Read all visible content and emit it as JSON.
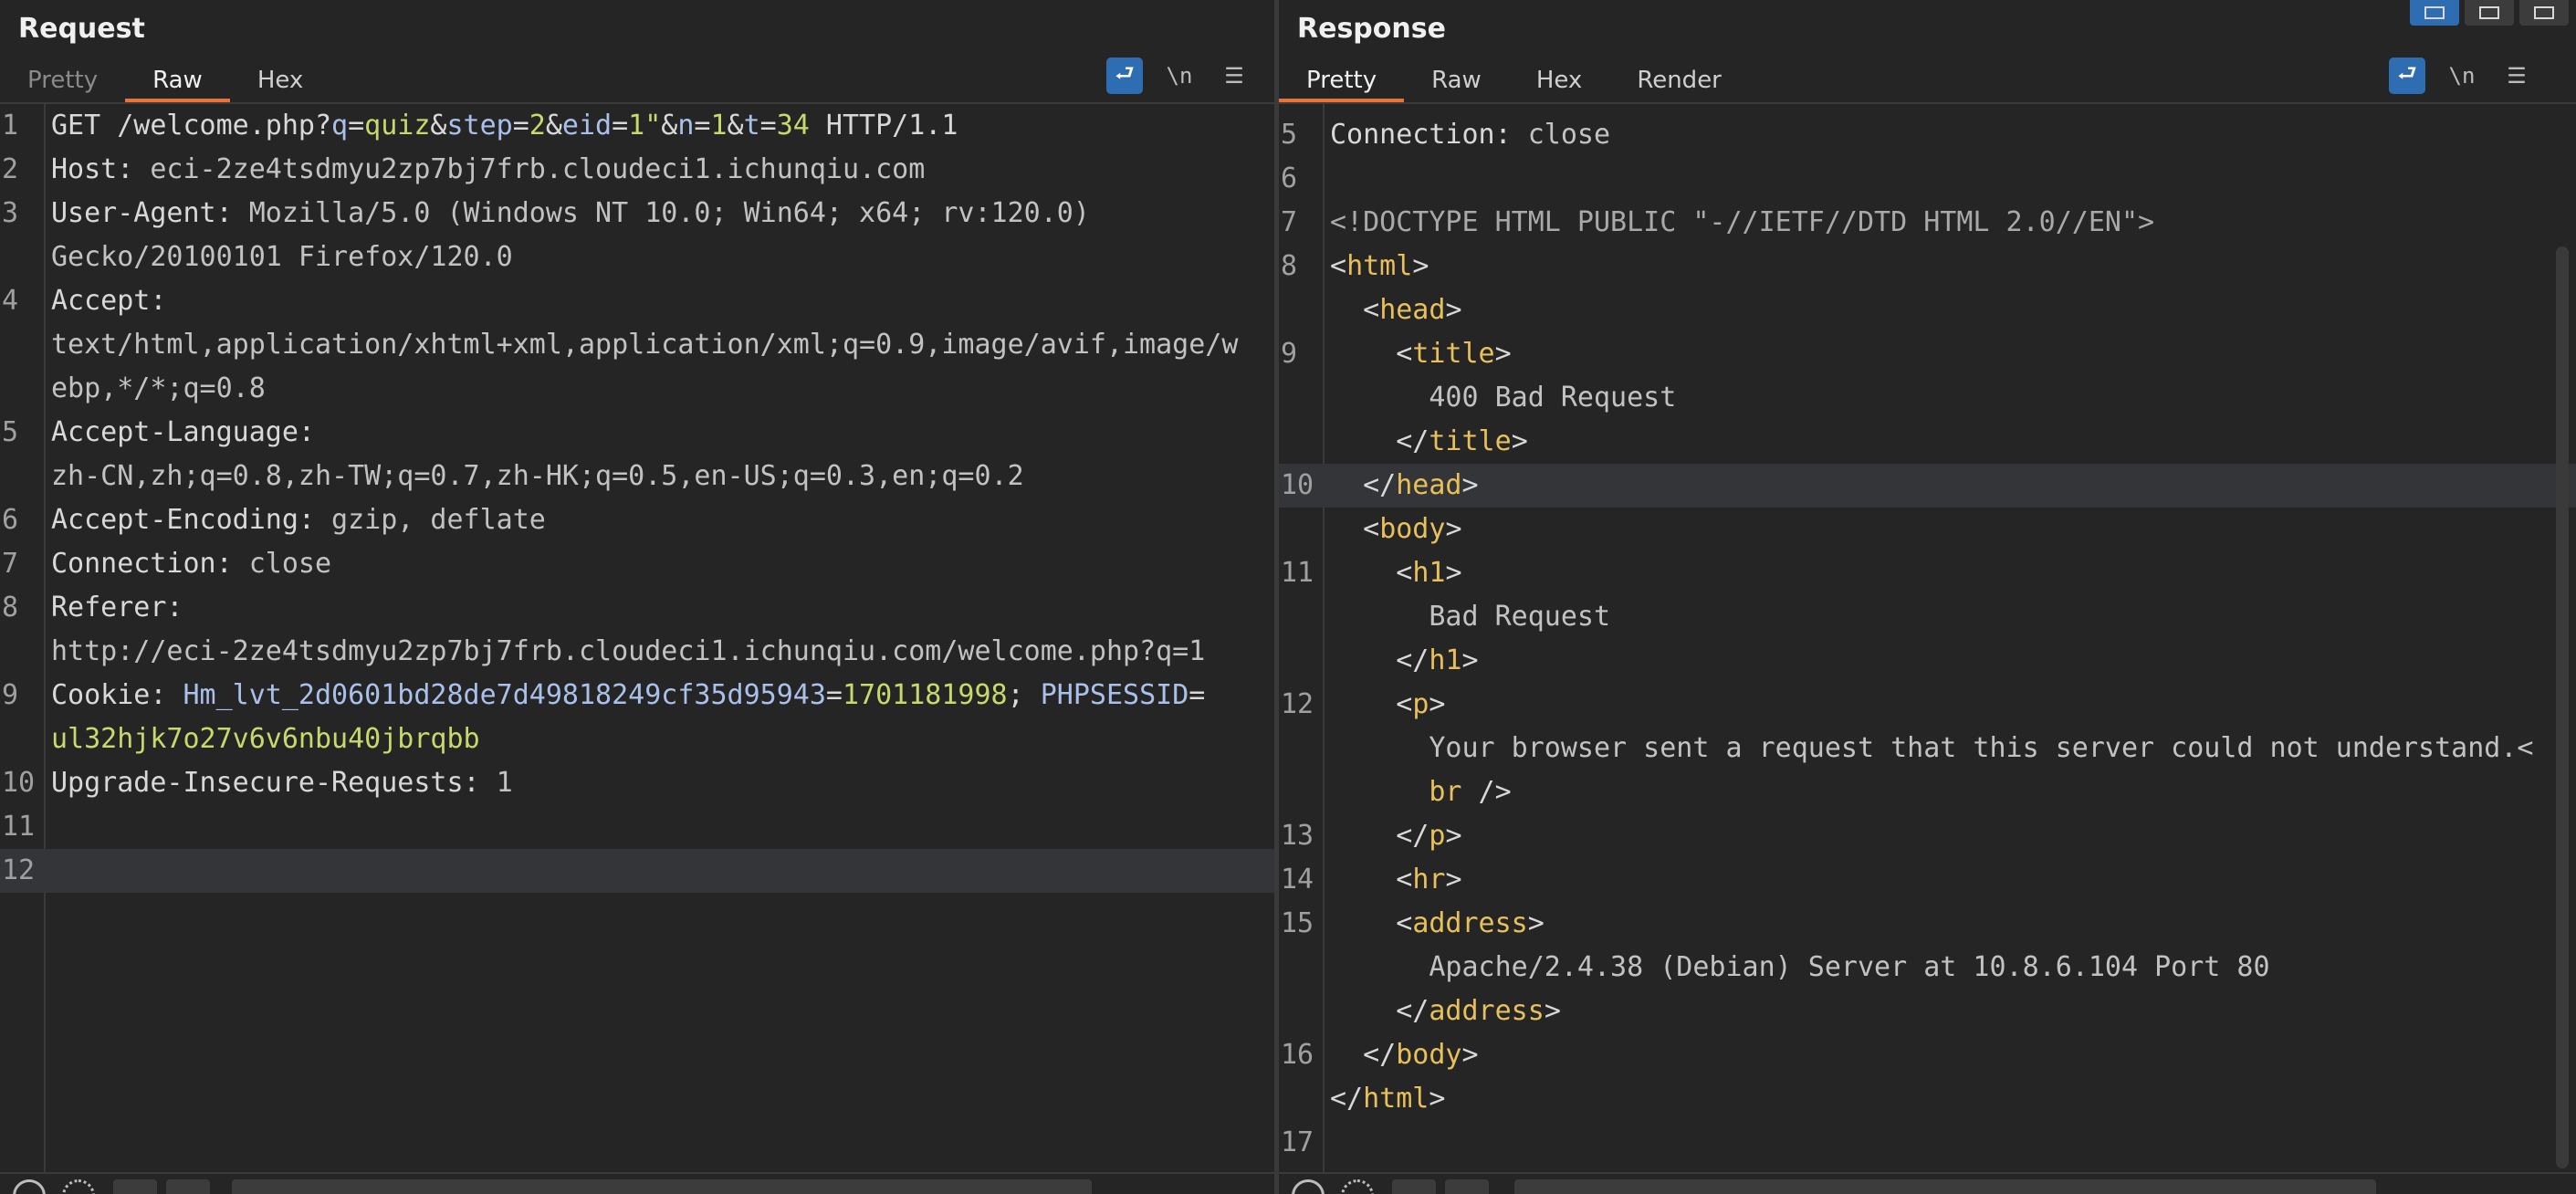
{
  "request": {
    "title": "Request",
    "tabs": [
      "Pretty",
      "Raw",
      "Hex"
    ],
    "active_tab": "Raw",
    "tools": {
      "wrap_icon": "wrap-lines-icon",
      "newline_label": "\\n",
      "menu_icon": "menu-icon"
    },
    "lines": [
      {
        "n": "1",
        "parts": [
          {
            "t": "GET /welcome.php?",
            "c": "k"
          },
          {
            "t": "q",
            "c": "pn"
          },
          {
            "t": "=",
            "c": "k"
          },
          {
            "t": "quiz",
            "c": "pv"
          },
          {
            "t": "&",
            "c": "k"
          },
          {
            "t": "step",
            "c": "pn"
          },
          {
            "t": "=",
            "c": "k"
          },
          {
            "t": "2",
            "c": "pv"
          },
          {
            "t": "&",
            "c": "k"
          },
          {
            "t": "eid",
            "c": "pn"
          },
          {
            "t": "=",
            "c": "k"
          },
          {
            "t": "1\"",
            "c": "pv"
          },
          {
            "t": "&",
            "c": "k"
          },
          {
            "t": "n",
            "c": "pn"
          },
          {
            "t": "=",
            "c": "k"
          },
          {
            "t": "1",
            "c": "pv"
          },
          {
            "t": "&",
            "c": "k"
          },
          {
            "t": "t",
            "c": "pn"
          },
          {
            "t": "=",
            "c": "k"
          },
          {
            "t": "34",
            "c": "pv"
          },
          {
            "t": " HTTP/1.1",
            "c": "k"
          }
        ]
      },
      {
        "n": "2",
        "parts": [
          {
            "t": "Host: ",
            "c": "k"
          },
          {
            "t": "eci-2ze4tsdmyu2zp7bj7frb.cloudeci1.ichunqiu.com",
            "c": "v"
          }
        ]
      },
      {
        "n": "3",
        "parts": [
          {
            "t": "User-Agent: ",
            "c": "k"
          },
          {
            "t": "Mozilla/5.0 (Windows NT 10.0; Win64; x64; rv:120.0)",
            "c": "v"
          }
        ]
      },
      {
        "n": "",
        "parts": [
          {
            "t": "Gecko/20100101 Firefox/120.0",
            "c": "v"
          }
        ]
      },
      {
        "n": "4",
        "parts": [
          {
            "t": "Accept:",
            "c": "k"
          }
        ]
      },
      {
        "n": "",
        "parts": [
          {
            "t": "text/html,application/xhtml+xml,application/xml;q=0.9,image/avif,image/w",
            "c": "v"
          }
        ]
      },
      {
        "n": "",
        "parts": [
          {
            "t": "ebp,*/*;q=0.8",
            "c": "v"
          }
        ]
      },
      {
        "n": "5",
        "parts": [
          {
            "t": "Accept-Language:",
            "c": "k"
          }
        ]
      },
      {
        "n": "",
        "parts": [
          {
            "t": "zh-CN,zh;q=0.8,zh-TW;q=0.7,zh-HK;q=0.5,en-US;q=0.3,en;q=0.2",
            "c": "v"
          }
        ]
      },
      {
        "n": "6",
        "parts": [
          {
            "t": "Accept-Encoding: ",
            "c": "k"
          },
          {
            "t": "gzip, deflate",
            "c": "v"
          }
        ]
      },
      {
        "n": "7",
        "parts": [
          {
            "t": "Connection: ",
            "c": "k"
          },
          {
            "t": "close",
            "c": "v"
          }
        ]
      },
      {
        "n": "8",
        "parts": [
          {
            "t": "Referer:",
            "c": "k"
          }
        ]
      },
      {
        "n": "",
        "parts": [
          {
            "t": "http://eci-2ze4tsdmyu2zp7bj7frb.cloudeci1.ichunqiu.com/welcome.php?q=1",
            "c": "v"
          }
        ]
      },
      {
        "n": "9",
        "parts": [
          {
            "t": "Cookie: ",
            "c": "k"
          },
          {
            "t": "Hm_lvt_2d0601bd28de7d49818249cf35d95943",
            "c": "pn"
          },
          {
            "t": "=",
            "c": "k"
          },
          {
            "t": "1701181998",
            "c": "pv"
          },
          {
            "t": "; ",
            "c": "k"
          },
          {
            "t": "PHPSESSID",
            "c": "pn"
          },
          {
            "t": "=",
            "c": "k"
          }
        ]
      },
      {
        "n": "",
        "parts": [
          {
            "t": "ul32hjk7o27v6v6nbu40jbrqbb",
            "c": "pv"
          }
        ]
      },
      {
        "n": "10",
        "parts": [
          {
            "t": "Upgrade-Insecure-Requests: ",
            "c": "k"
          },
          {
            "t": "1",
            "c": "v"
          }
        ]
      },
      {
        "n": "11",
        "parts": []
      },
      {
        "n": "12",
        "parts": [],
        "hl": true
      }
    ]
  },
  "response": {
    "title": "Response",
    "tabs": [
      "Pretty",
      "Raw",
      "Hex",
      "Render"
    ],
    "active_tab": "Pretty",
    "tools": {
      "wrap_icon": "wrap-lines-icon",
      "newline_label": "\\n",
      "menu_icon": "menu-icon"
    },
    "layout_buttons": [
      "layout-split-icon",
      "layout-stacked-icon",
      "layout-single-icon"
    ],
    "lines": [
      {
        "n": "5",
        "parts": [
          {
            "t": "Connection: ",
            "c": "k"
          },
          {
            "t": "close",
            "c": "v"
          }
        ]
      },
      {
        "n": "6",
        "parts": []
      },
      {
        "n": "7",
        "parts": [
          {
            "t": "<!DOCTYPE HTML PUBLIC \"-//IETF//DTD HTML 2.0//EN\">",
            "c": "cm"
          }
        ]
      },
      {
        "n": "8",
        "parts": [
          {
            "t": "<",
            "c": "k"
          },
          {
            "t": "html",
            "c": "tg"
          },
          {
            "t": ">",
            "c": "k"
          }
        ]
      },
      {
        "n": "",
        "parts": [
          {
            "t": "  <",
            "c": "k"
          },
          {
            "t": "head",
            "c": "tg"
          },
          {
            "t": ">",
            "c": "k"
          }
        ]
      },
      {
        "n": "9",
        "parts": [
          {
            "t": "    <",
            "c": "k"
          },
          {
            "t": "title",
            "c": "tg"
          },
          {
            "t": ">",
            "c": "k"
          }
        ]
      },
      {
        "n": "",
        "parts": [
          {
            "t": "      400 Bad Request",
            "c": "v"
          }
        ]
      },
      {
        "n": "",
        "parts": [
          {
            "t": "    </",
            "c": "k"
          },
          {
            "t": "title",
            "c": "tg"
          },
          {
            "t": ">",
            "c": "k"
          }
        ]
      },
      {
        "n": "10",
        "parts": [
          {
            "t": "  </",
            "c": "k"
          },
          {
            "t": "head",
            "c": "tg"
          },
          {
            "t": ">",
            "c": "k"
          }
        ],
        "hl": true
      },
      {
        "n": "",
        "parts": [
          {
            "t": "  <",
            "c": "k"
          },
          {
            "t": "body",
            "c": "tg"
          },
          {
            "t": ">",
            "c": "k"
          }
        ]
      },
      {
        "n": "11",
        "parts": [
          {
            "t": "    <",
            "c": "k"
          },
          {
            "t": "h1",
            "c": "tg"
          },
          {
            "t": ">",
            "c": "k"
          }
        ]
      },
      {
        "n": "",
        "parts": [
          {
            "t": "      Bad Request",
            "c": "v"
          }
        ]
      },
      {
        "n": "",
        "parts": [
          {
            "t": "    </",
            "c": "k"
          },
          {
            "t": "h1",
            "c": "tg"
          },
          {
            "t": ">",
            "c": "k"
          }
        ]
      },
      {
        "n": "12",
        "parts": [
          {
            "t": "    <",
            "c": "k"
          },
          {
            "t": "p",
            "c": "tg"
          },
          {
            "t": ">",
            "c": "k"
          }
        ]
      },
      {
        "n": "",
        "parts": [
          {
            "t": "      Your browser sent a request that this server could not understand.<",
            "c": "v"
          }
        ]
      },
      {
        "n": "",
        "parts": [
          {
            "t": "      ",
            "c": "v"
          },
          {
            "t": "br",
            "c": "tg"
          },
          {
            "t": " />",
            "c": "k"
          }
        ]
      },
      {
        "n": "13",
        "parts": [
          {
            "t": "    </",
            "c": "k"
          },
          {
            "t": "p",
            "c": "tg"
          },
          {
            "t": ">",
            "c": "k"
          }
        ]
      },
      {
        "n": "14",
        "parts": [
          {
            "t": "    <",
            "c": "k"
          },
          {
            "t": "hr",
            "c": "tg"
          },
          {
            "t": ">",
            "c": "k"
          }
        ]
      },
      {
        "n": "15",
        "parts": [
          {
            "t": "    <",
            "c": "k"
          },
          {
            "t": "address",
            "c": "tg"
          },
          {
            "t": ">",
            "c": "k"
          }
        ]
      },
      {
        "n": "",
        "parts": [
          {
            "t": "      Apache/2.4.38 (Debian) Server at 10.8.6.104 Port 80",
            "c": "v"
          }
        ]
      },
      {
        "n": "",
        "parts": [
          {
            "t": "    </",
            "c": "k"
          },
          {
            "t": "address",
            "c": "tg"
          },
          {
            "t": ">",
            "c": "k"
          }
        ]
      },
      {
        "n": "16",
        "parts": [
          {
            "t": "  </",
            "c": "k"
          },
          {
            "t": "body",
            "c": "tg"
          },
          {
            "t": ">",
            "c": "k"
          }
        ]
      },
      {
        "n": "",
        "parts": [
          {
            "t": "</",
            "c": "k"
          },
          {
            "t": "html",
            "c": "tg"
          },
          {
            "t": ">",
            "c": "k"
          }
        ]
      },
      {
        "n": "17",
        "parts": []
      }
    ]
  },
  "colors": {
    "accent": "#e8733a",
    "button_blue": "#2f6db3",
    "param_name": "#a9c1ea",
    "param_value": "#c8d86a",
    "tag": "#e8c05a"
  }
}
